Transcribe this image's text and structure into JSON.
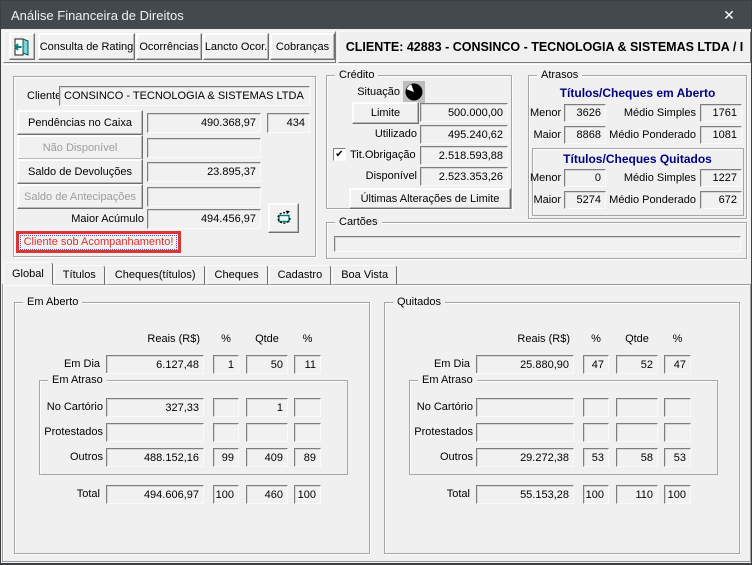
{
  "window": {
    "title": "Análise Financeira de Direitos",
    "close_glyph": "✕"
  },
  "toolbar": {
    "rating_button": "Consulta de Rating",
    "ocorrencias_button": "Ocorrências",
    "lancto_button": "Lancto Ocor.",
    "cobrancas_button": "Cobranças",
    "client_header": "CLIENTE: 42883 - CONSINCO - TECNOLOGIA & SISTEMAS LTDA  /  I"
  },
  "client_panel": {
    "cliente_label": "Cliente",
    "cliente_value": "CONSINCO - TECNOLOGIA & SISTEMAS LTDA",
    "pendencias_button": "Pendências no Caixa",
    "pendencias_value": "490.368,97",
    "pendencias_qty": "434",
    "nao_disponivel_button": "Não Disponível",
    "nao_disponivel_value": "",
    "devolucoes_button": "Saldo de Devoluções",
    "devolucoes_value": "23.895,37",
    "antecipacoes_button": "Saldo de Antecipações",
    "antecipacoes_value": "",
    "maior_acumulo_label": "Maior Acúmulo",
    "maior_acumulo_value": "494.456,97",
    "warning_text": "Cliente sob Acompanhamento!"
  },
  "credito": {
    "title": "Crédito",
    "situacao_label": "Situação",
    "limite_button": "Limite",
    "limite_value": "500.000,00",
    "utilizado_label": "Utilizado",
    "utilizado_value": "495.240,62",
    "tit_obrigacao_label": "Tit.Obrigação",
    "tit_obrigacao_checked": "✔",
    "tit_obrigacao_value": "2.518.593,88",
    "disponivel_label": "Disponível",
    "disponivel_value": "2.523.353,26",
    "ultimas_alteracoes_button": "Últimas Alterações de Limite"
  },
  "atrasos": {
    "title": "Atrasos",
    "em_aberto": {
      "title": "Títulos/Cheques em Aberto",
      "menor_label": "Menor",
      "menor": "3626",
      "medio_simples_label": "Médio Simples",
      "medio_simples": "1761",
      "maior_label": "Maior",
      "maior": "8868",
      "medio_ponderado_label": "Médio Ponderado",
      "medio_ponderado": "1081"
    },
    "quitados": {
      "title": "Títulos/Cheques Quitados",
      "menor_label": "Menor",
      "menor": "0",
      "medio_simples_label": "Médio Simples",
      "medio_simples": "1227",
      "maior_label": "Maior",
      "maior": "5274",
      "medio_ponderado_label": "Médio Ponderado",
      "medio_ponderado": "672"
    }
  },
  "cartoes": {
    "title": "Cartões",
    "value": ""
  },
  "tabs": [
    {
      "label": "Global",
      "active": true
    },
    {
      "label": "Títulos",
      "active": false
    },
    {
      "label": "Cheques(títulos)",
      "active": false
    },
    {
      "label": "Cheques",
      "active": false
    },
    {
      "label": "Cadastro",
      "active": false
    },
    {
      "label": "Boa Vista",
      "active": false
    }
  ],
  "stats": {
    "headers": {
      "reais": "Reais (R$)",
      "pct": "%",
      "qtde": "Qtde"
    },
    "em_atraso_title": "Em Atraso",
    "row_labels": {
      "em_dia": "Em Dia",
      "no_cartorio": "No Cartório",
      "protestados": "Protestados",
      "outros": "Outros",
      "total": "Total"
    },
    "em_aberto": {
      "title": "Em Aberto",
      "em_dia": {
        "reais": "6.127,48",
        "pct1": "1",
        "qtde": "50",
        "pct2": "11"
      },
      "no_cartorio": {
        "reais": "327,33",
        "pct1": "",
        "qtde": "1",
        "pct2": ""
      },
      "protestados": {
        "reais": "",
        "pct1": "",
        "qtde": "",
        "pct2": ""
      },
      "outros": {
        "reais": "488.152,16",
        "pct1": "99",
        "qtde": "409",
        "pct2": "89"
      },
      "total": {
        "reais": "494.606,97",
        "pct1": "100",
        "qtde": "460",
        "pct2": "100"
      }
    },
    "quitados": {
      "title": "Quitados",
      "em_dia": {
        "reais": "25.880,90",
        "pct1": "47",
        "qtde": "52",
        "pct2": "47"
      },
      "no_cartorio": {
        "reais": "",
        "pct1": "",
        "qtde": "",
        "pct2": ""
      },
      "protestados": {
        "reais": "",
        "pct1": "",
        "qtde": "",
        "pct2": ""
      },
      "outros": {
        "reais": "29.272,38",
        "pct1": "53",
        "qtde": "58",
        "pct2": "53"
      },
      "total": {
        "reais": "55.153,28",
        "pct1": "100",
        "qtde": "110",
        "pct2": "100"
      }
    }
  },
  "colors": {
    "titlebar": "#44494d",
    "navy_title": "#00007f",
    "warning_red": "#e03030",
    "warning_border": "#d93535",
    "icon_teal": "#007d7d"
  }
}
